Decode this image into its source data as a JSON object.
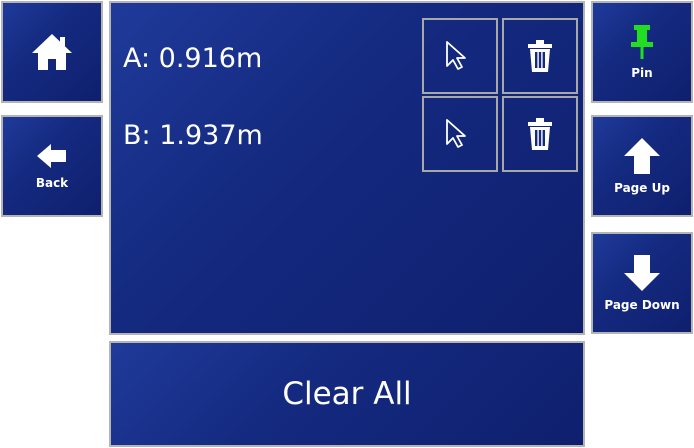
{
  "nav": {
    "home_icon": "home-icon",
    "back_label": "Back",
    "back_icon": "arrow-left-icon"
  },
  "right_nav": {
    "pin_label": "Pin",
    "pin_icon": "pushpin-icon",
    "pin_color": "#22dd22",
    "page_up_label": "Page Up",
    "page_up_icon": "arrow-up-icon",
    "page_down_label": "Page Down",
    "page_down_icon": "arrow-down-icon"
  },
  "measurements": [
    {
      "text": "A: 0.916m",
      "select_icon": "cursor-arrow-icon",
      "delete_icon": "trash-icon"
    },
    {
      "text": "B: 1.937m",
      "select_icon": "cursor-arrow-icon",
      "delete_icon": "trash-icon"
    }
  ],
  "clear_all_label": "Clear All",
  "colors": {
    "tile_bg": "#142a80",
    "tile_border": "#b4b4b4",
    "text": "#ffffff"
  }
}
